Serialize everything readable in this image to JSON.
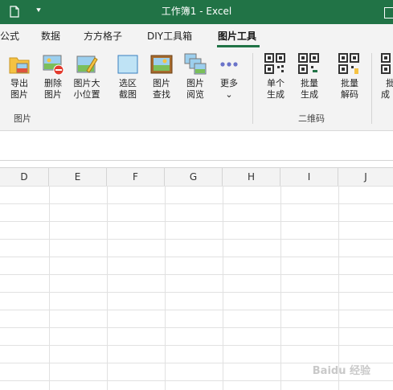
{
  "titlebar": {
    "title": "工作簿1  -  Excel",
    "qat_arrow": "⯆"
  },
  "tabs": [
    {
      "label": "公式"
    },
    {
      "label": "数据"
    },
    {
      "label": "方方格子"
    },
    {
      "label": "DIY工具箱"
    },
    {
      "label": "图片工具",
      "active": true
    }
  ],
  "ribbon": {
    "groups": [
      {
        "label": "图片"
      },
      {
        "label": "二维码"
      }
    ],
    "buttons": [
      {
        "label1": "导出",
        "label2": "图片",
        "icon": "export-image-icon"
      },
      {
        "label1": "删除",
        "label2": "图片",
        "icon": "delete-image-icon"
      },
      {
        "label1": "图片大",
        "label2": "小位置",
        "icon": "resize-image-icon"
      },
      {
        "label1": "选区",
        "label2": "截图",
        "icon": "screenshot-icon"
      },
      {
        "label1": "图片",
        "label2": "查找",
        "icon": "find-image-icon"
      },
      {
        "label1": "图片",
        "label2": "阅览",
        "icon": "image-viewer-icon"
      },
      {
        "label1": "更多",
        "label2": "⌄",
        "icon": "more-icon"
      },
      {
        "label1": "单个",
        "label2": "生成",
        "icon": "qr-single-icon"
      },
      {
        "label1": "批量",
        "label2": "生成",
        "icon": "qr-batch-icon"
      },
      {
        "label1": "批量",
        "label2": "解码",
        "icon": "qr-decode-icon"
      },
      {
        "label1": "批",
        "label2": "成",
        "icon": "qr-partial-icon"
      }
    ]
  },
  "grid": {
    "columns": [
      "D",
      "E",
      "F",
      "G",
      "H",
      "I",
      "J"
    ]
  },
  "watermark": "Baidu 经验",
  "colors": {
    "accent": "#217346",
    "ribbon_bg": "#f3f3f3",
    "delete_red": "#e23b2e"
  }
}
